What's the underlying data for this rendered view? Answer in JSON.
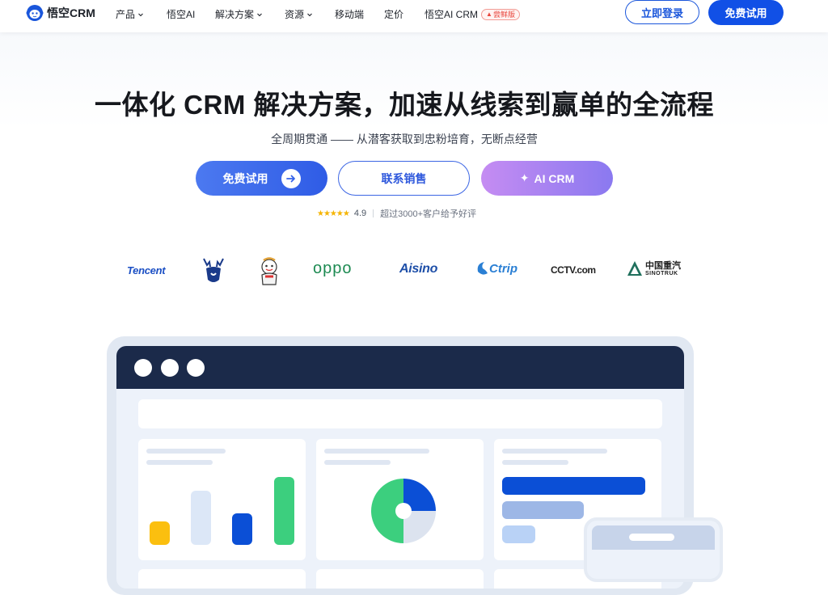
{
  "header": {
    "logo_text": "悟空CRM",
    "nav": [
      {
        "label": "产品",
        "dropdown": true
      },
      {
        "label": "悟空AI",
        "dropdown": false
      },
      {
        "label": "解决方案",
        "dropdown": true
      },
      {
        "label": "资源",
        "dropdown": true
      },
      {
        "label": "移动端",
        "dropdown": false
      },
      {
        "label": "定价",
        "dropdown": false
      },
      {
        "label": "悟空AI CRM",
        "dropdown": false,
        "badge": "尝鲜版"
      }
    ],
    "login_label": "立即登录",
    "trial_label": "免费试用"
  },
  "hero": {
    "title": "一体化 CRM 解决方案，加速从线索到赢单的全流程",
    "subtitle": "全周期贯通 —— 从潜客获取到忠粉培育，无断点经营",
    "cta_trial": "免费试用",
    "cta_sales": "联系销售",
    "cta_ai": "AI CRM",
    "rating_stars": "★★★★★",
    "rating_score": "4.9",
    "rating_text": "超过3000+客户给予好评"
  },
  "logos": [
    {
      "name": "Tencent",
      "text": "Tencent"
    },
    {
      "name": "deer-brand",
      "text": ""
    },
    {
      "name": "cartoon-mascot",
      "text": ""
    },
    {
      "name": "OPPO",
      "text": "oppo"
    },
    {
      "name": "Aisino",
      "text": "Aisino"
    },
    {
      "name": "Ctrip",
      "text": "Ctrip"
    },
    {
      "name": "CCTV.com",
      "text": "CCTV.com"
    },
    {
      "name": "SINOTRUK",
      "text": "中国重汽",
      "subtext": "SINOTRUK"
    }
  ],
  "colors": {
    "primary": "#1150e6",
    "nav_dark": "#1b2a4a",
    "green": "#3ccf7e",
    "yellow": "#fbbf0f",
    "blue": "#0b4fd6",
    "light_blue": "#dce7f7"
  }
}
